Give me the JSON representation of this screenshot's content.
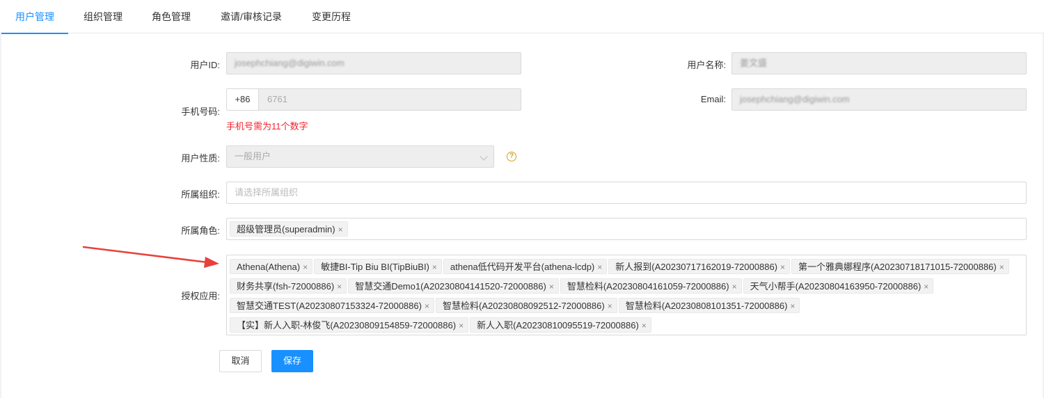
{
  "tabs": [
    {
      "label": "用户管理",
      "active": true
    },
    {
      "label": "组织管理"
    },
    {
      "label": "角色管理"
    },
    {
      "label": "邀请/审核记录"
    },
    {
      "label": "变更历程"
    }
  ],
  "form": {
    "user_id": {
      "label": "用户ID:",
      "value": "josephchiang@digiwin.com"
    },
    "user_name": {
      "label": "用户名称:",
      "value": "姜文盛"
    },
    "phone": {
      "label": "手机号码:",
      "prefix": "+86",
      "value": "6761",
      "error": "手机号需为11个数字"
    },
    "email": {
      "label": "Email:",
      "value": "josephchiang@digiwin.com"
    },
    "user_type": {
      "label": "用户性质:",
      "value": "一般用户",
      "help": "?"
    },
    "organization": {
      "label": "所属组织:",
      "placeholder": "请选择所属组织"
    },
    "roles": {
      "label": "所属角色:",
      "tags": [
        "超级管理员(superadmin)"
      ]
    },
    "apps": {
      "label": "授权应用:",
      "tags": [
        "Athena(Athena)",
        "敏捷BI-Tip Biu BI(TipBiuBI)",
        "athena低代码开发平台(athena-lcdp)",
        "新人报到(A20230717162019-72000886)",
        "第一个雅典娜程序(A20230718171015-72000886)",
        "财务共享(fsh-72000886)",
        "智慧交通Demo1(A20230804141520-72000886)",
        "智慧检料(A20230804161059-72000886)",
        "天气小帮手(A20230804163950-72000886)",
        "智慧交通TEST(A20230807153324-72000886)",
        "智慧检料(A20230808092512-72000886)",
        "智慧检料(A20230808101351-72000886)",
        "【实】新人入职-林俊飞(A20230809154859-72000886)",
        "新人入职(A20230810095519-72000886)"
      ]
    }
  },
  "tag_remove": "×",
  "buttons": {
    "cancel": "取消",
    "save": "保存"
  },
  "colors": {
    "accent": "#1890ff",
    "error": "#f5222d",
    "arrow": "#e8413b",
    "help": "#d4a017"
  }
}
